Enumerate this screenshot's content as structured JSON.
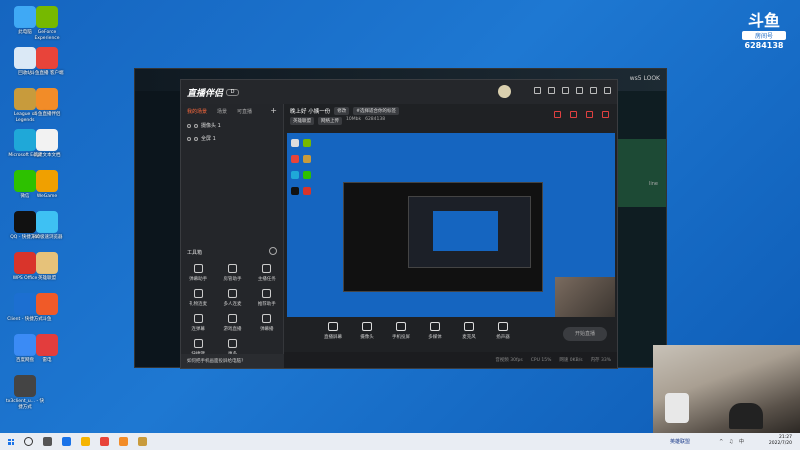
{
  "desktop": {
    "icons": [
      {
        "label": "此电脑",
        "color": "#3fa9f5"
      },
      {
        "label": "GeForce Experience",
        "color": "#76b900"
      },
      {
        "label": "回收站",
        "color": "#dbe9f6"
      },
      {
        "label": "斗鱼直播 客户端",
        "color": "#e8443a"
      },
      {
        "label": "League of Legends",
        "color": "#c89b3c"
      },
      {
        "label": "斗鱼直播伴侣",
        "color": "#f28c28"
      },
      {
        "label": "Microsoft Edge",
        "color": "#1fa8d8"
      },
      {
        "label": "新建文本文档",
        "color": "#f2f2f2"
      },
      {
        "label": "微信",
        "color": "#2dc100"
      },
      {
        "label": "WeGame",
        "color": "#f0a000"
      },
      {
        "label": "QQ - 快捷方式",
        "color": "#111111"
      },
      {
        "label": "360极速浏览器",
        "color": "#3ec1f3"
      },
      {
        "label": "WPS Office",
        "color": "#d9342b"
      },
      {
        "label": "英雄联盟",
        "color": "#e6c27a"
      },
      {
        "label": "Client - 快捷方式",
        "color": "#1c6fd1"
      },
      {
        "label": "斗鱼",
        "color": "#f05a28"
      },
      {
        "label": "百度网盘",
        "color": "#3b8bf5"
      },
      {
        "label": "雷电",
        "color": "#e33d3d"
      },
      {
        "label": "tx3client_u... - 快捷方式",
        "color": "#444444"
      }
    ]
  },
  "watermark": {
    "logo": "斗鱼",
    "room_label": "房间号",
    "room_number": "6284138"
  },
  "lol_client": {
    "topright": "ws5 LOOK",
    "side_text": "line"
  },
  "live_app": {
    "logo": "直播伴侣",
    "badge": "D",
    "tabs": [
      "我的场景",
      "场景",
      "可直播"
    ],
    "sources": [
      "摄像头 1",
      "全屏 1"
    ],
    "tools_title": "工具箱",
    "tools": [
      {
        "label": "弹幕助手"
      },
      {
        "label": "房管助手"
      },
      {
        "label": "主播任务"
      },
      {
        "label": "礼物连麦"
      },
      {
        "label": "多人连麦"
      },
      {
        "label": "推荐助手"
      },
      {
        "label": "连弹幕"
      },
      {
        "label": "游戏直播"
      },
      {
        "label": "弹幕播"
      },
      {
        "label": "快捷键"
      },
      {
        "label": "更多"
      }
    ],
    "bottom_tip": "如何把手机画面投屏给电脑?",
    "room_title": "晚上好 小姨一份",
    "title_tags": [
      "修改",
      "#选择适合你的标签"
    ],
    "sub_info": [
      "英雄联盟",
      "网络上传",
      "10Mbk",
      "6284138"
    ],
    "controls": [
      {
        "label": "直播屏幕"
      },
      {
        "label": "摄像头"
      },
      {
        "label": "手机投屏"
      },
      {
        "label": "多媒体"
      },
      {
        "label": "麦克风"
      },
      {
        "label": "扬声器"
      }
    ],
    "start_button": "开始直播",
    "status": [
      "音视频 30fps",
      "CPU 15%",
      "网速 0KB/s",
      "内存 33%"
    ]
  },
  "taskbar": {
    "game_label": "英雄联盟",
    "time": "21:27",
    "date": "2022/7/20",
    "sys": "^ ♫ 中"
  },
  "colors": {
    "accent": "#ff6a3d",
    "desktop_blue": "#1565c0"
  }
}
